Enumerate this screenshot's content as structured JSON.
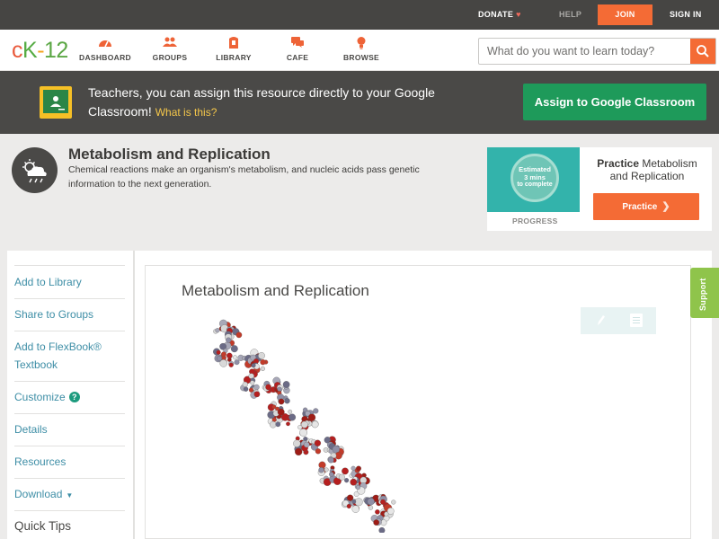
{
  "topbar": {
    "donate": "DONATE",
    "help": "HELP",
    "join": "JOIN",
    "signin": "SIGN IN"
  },
  "nav": {
    "logo": {
      "c": "c",
      "k": "K",
      "dash": "-",
      "n": "12"
    },
    "items": [
      {
        "label": "DASHBOARD",
        "icon": "dashboard-icon"
      },
      {
        "label": "GROUPS",
        "icon": "groups-icon"
      },
      {
        "label": "LIBRARY",
        "icon": "library-icon"
      },
      {
        "label": "CAFE",
        "icon": "cafe-icon"
      },
      {
        "label": "BROWSE",
        "icon": "browse-icon"
      }
    ],
    "search_placeholder": "What do you want to learn today?"
  },
  "banner": {
    "text": "Teachers, you can assign this resource directly to your Google Classroom!",
    "what": "What is this?",
    "button": "Assign to Google Classroom"
  },
  "topic": {
    "title": "Metabolism and Replication",
    "description": "Chemical reactions make an organism's metabolism, and nucleic acids pass genetic information to the next generation."
  },
  "practice": {
    "circle_line1": "Estimated",
    "circle_line2": "3 mins",
    "circle_line3": "to complete",
    "progress_label": "PROGRESS",
    "title_bold": "Practice",
    "title_rest": "Metabolism and Replication",
    "button": "Practice"
  },
  "sidebar": {
    "items": [
      {
        "label": "Add to Library"
      },
      {
        "label": "Share to Groups"
      },
      {
        "label": "Add to FlexBook® Textbook"
      },
      {
        "label": "Customize"
      },
      {
        "label": "Details"
      },
      {
        "label": "Resources"
      },
      {
        "label": "Download"
      }
    ],
    "quick_tips": "Quick Tips",
    "customize_help": "?"
  },
  "content": {
    "title": "Metabolism and Replication"
  },
  "support": "Support",
  "colors": {
    "accent": "#f46b35",
    "green_button": "#1e9a5a",
    "link": "#3e8ea6",
    "support": "#8fc44b"
  }
}
